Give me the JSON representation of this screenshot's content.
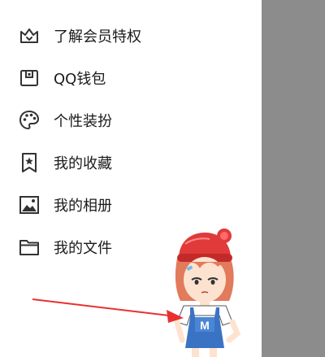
{
  "menu": {
    "items": [
      {
        "label": "了解会员特权",
        "icon": "crown-icon"
      },
      {
        "label": "QQ钱包",
        "icon": "wallet-icon"
      },
      {
        "label": "个性装扮",
        "icon": "palette-icon"
      },
      {
        "label": "我的收藏",
        "icon": "bookmark-star-icon"
      },
      {
        "label": "我的相册",
        "icon": "photo-album-icon"
      },
      {
        "label": "我的文件",
        "icon": "folder-icon"
      }
    ]
  },
  "sticker": {
    "shirt_letter": "M"
  },
  "colors": {
    "icon_stroke": "#333333",
    "label_text": "#1a1a1a",
    "overlay": "#8c8c8c",
    "arrow": "#e8312f"
  }
}
